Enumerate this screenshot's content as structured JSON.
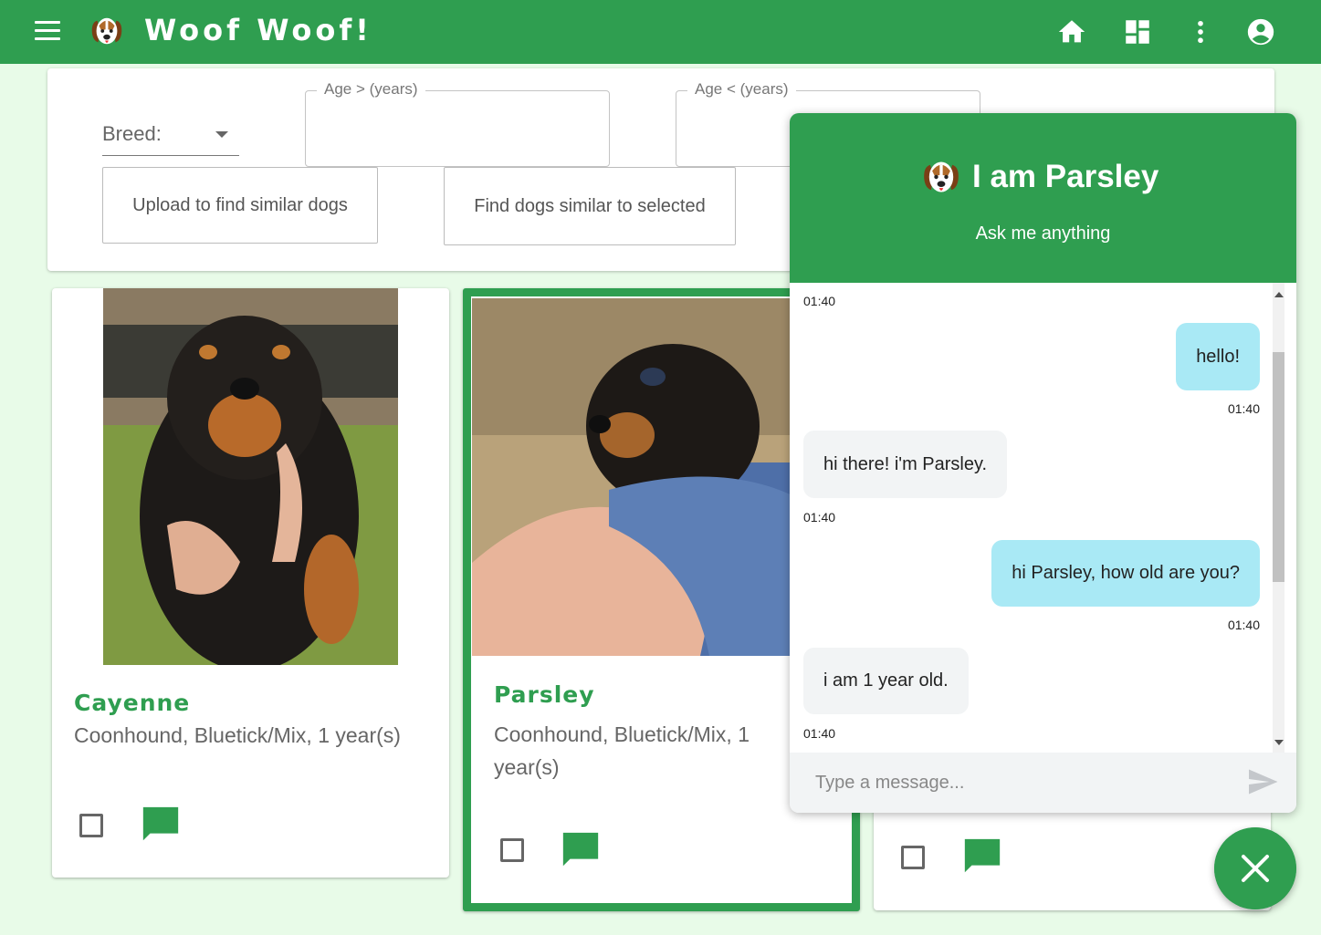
{
  "app": {
    "title": "Woof Woof!"
  },
  "filters": {
    "breed_label": "Breed:",
    "age_min_label": "Age > (years)",
    "age_min_value": "",
    "age_max_label": "Age < (years)",
    "age_max_value": "",
    "upload_button": "Upload to find similar dogs",
    "similar_button": "Find dogs similar to selected"
  },
  "dogs": [
    {
      "name": "Cayenne",
      "description": "Coonhound, Bluetick/Mix, 1 year(s)",
      "selected": false,
      "checked": false
    },
    {
      "name": "Parsley",
      "description": "Coonhound, Bluetick/Mix, 1 year(s)",
      "selected": true,
      "checked": false
    },
    {
      "name": "",
      "description": "",
      "selected": false,
      "checked": false
    }
  ],
  "chat": {
    "title": "I am Parsley",
    "subtitle": "Ask me anything",
    "messages": [
      {
        "from": "bot",
        "text": "",
        "time": "01:40"
      },
      {
        "from": "user",
        "text": "hello!",
        "time": "01:40"
      },
      {
        "from": "bot",
        "text": "hi there! i'm Parsley.",
        "time": "01:40"
      },
      {
        "from": "user",
        "text": "hi Parsley, how old are you?",
        "time": "01:40"
      },
      {
        "from": "bot",
        "text": "i am 1 year old.",
        "time": "01:40"
      }
    ],
    "input_placeholder": "Type a message...",
    "input_value": ""
  },
  "icons": {
    "menu": "hamburger-menu-icon",
    "logo": "beagle-logo-icon",
    "home": "home-icon",
    "dashboard": "dashboard-icon",
    "more": "more-vert-icon",
    "account": "account-circle-icon",
    "chat": "chat-bubble-icon",
    "send": "send-icon",
    "close": "close-icon"
  },
  "colors": {
    "brand_green": "#2f9e50",
    "page_background": "#e8fbe8",
    "user_bubble": "#a9e9f5",
    "bot_bubble": "#f2f4f5"
  }
}
